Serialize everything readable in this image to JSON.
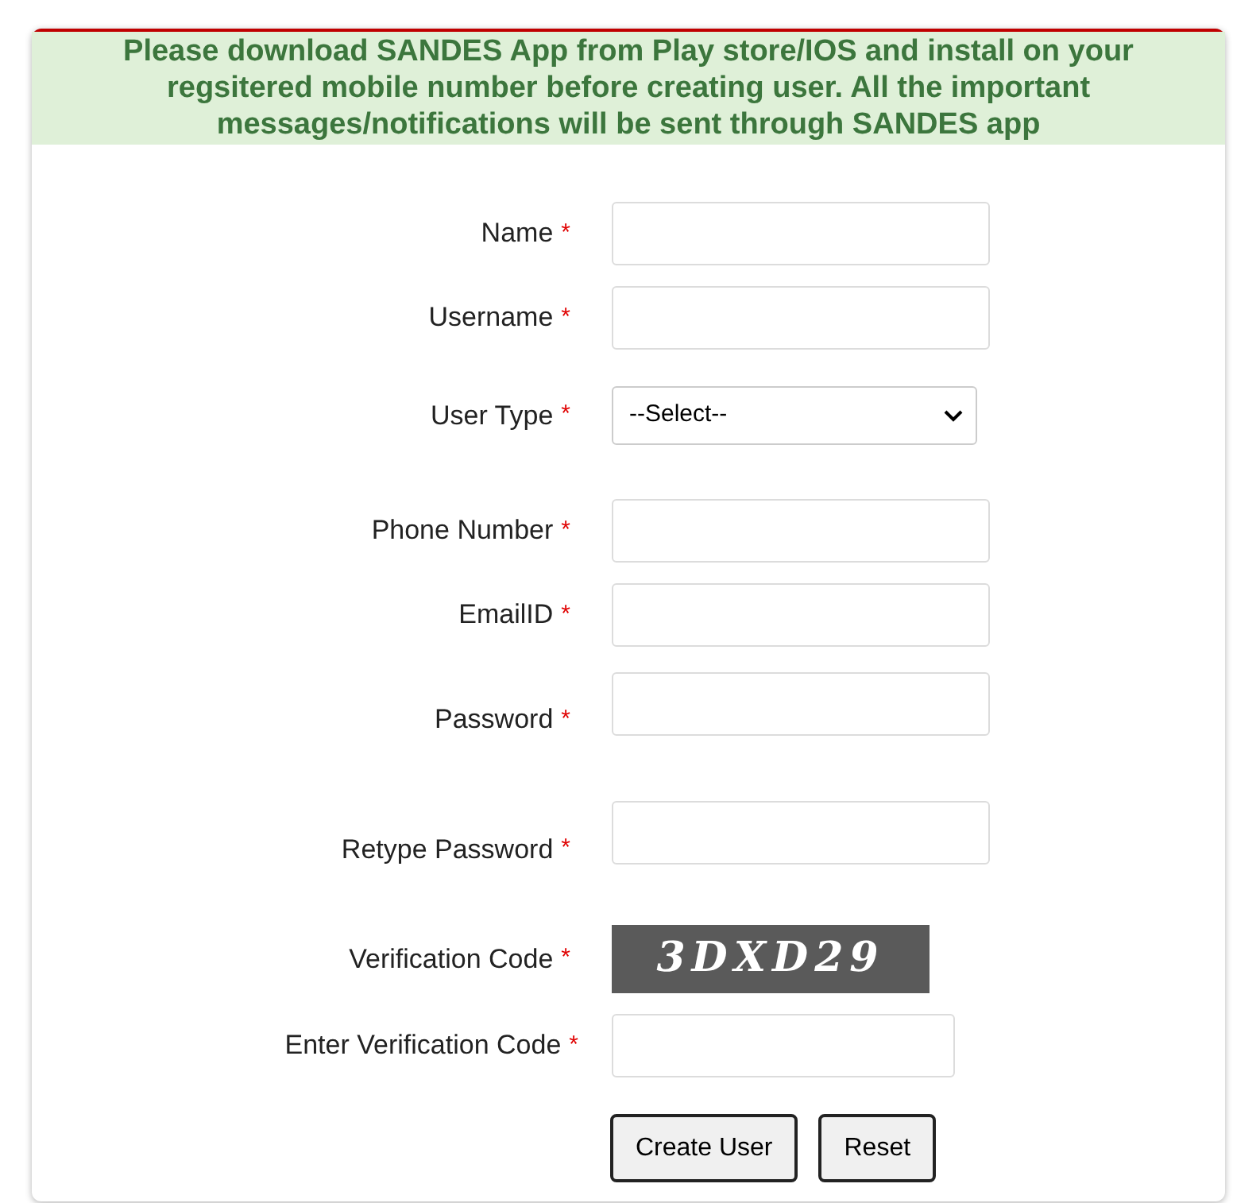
{
  "notice": "Please download SANDES App from Play store/IOS and install on your regsitered mobile number before creating user. All the important messages/notifications will be sent through SANDES app",
  "fields": [
    {
      "kind": "input",
      "label": "Name",
      "required": "*"
    },
    {
      "kind": "input",
      "label": "Username",
      "required": "*"
    },
    {
      "kind": "select",
      "label": "User Type",
      "required": "*",
      "value": "--Select--"
    },
    {
      "kind": "input",
      "label": "Phone Number",
      "required": "*"
    },
    {
      "kind": "input",
      "label": "EmailID",
      "required": "*"
    },
    {
      "kind": "input",
      "label": "Password",
      "required": "*"
    },
    {
      "kind": "input",
      "label": "Retype Password",
      "required": "*"
    },
    {
      "kind": "captcha",
      "label": "Verification Code",
      "required": "*",
      "value": "3DXD29"
    },
    {
      "kind": "input",
      "label": "Enter Verification Code",
      "required": "*"
    }
  ],
  "buttons": [
    "Create User",
    "Reset"
  ]
}
